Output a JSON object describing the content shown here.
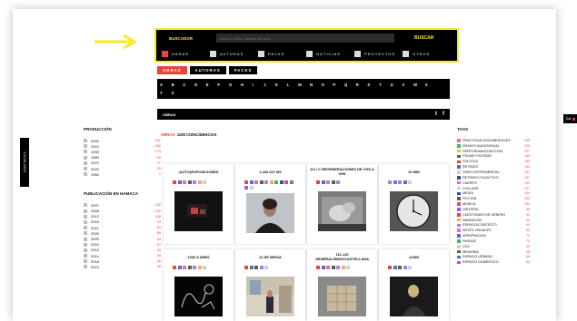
{
  "search": {
    "label": "BUSCADOR",
    "placeholder": "entra un título, nombre de autor ...",
    "button": "BUSCAR",
    "filters": [
      {
        "label": "OBRAS",
        "checked": true
      },
      {
        "label": "AUTORAS",
        "checked": false
      },
      {
        "label": "PACKS",
        "checked": false
      },
      {
        "label": "NOTICIAS",
        "checked": false
      },
      {
        "label": "PROYECTOS",
        "checked": false
      },
      {
        "label": "OTROS",
        "checked": false
      }
    ]
  },
  "tabs": [
    {
      "label": "OBRAS",
      "active": true
    },
    {
      "label": "AUTORAS",
      "active": false
    },
    {
      "label": "PACKS",
      "active": false
    }
  ],
  "alphabet": [
    "A",
    "B",
    "C",
    "D",
    "E",
    "F",
    "G",
    "H",
    "I",
    "J",
    "K",
    "L",
    "M",
    "N",
    "O",
    "P",
    "Q",
    "R",
    "S",
    "T",
    "U",
    "V",
    "W",
    "X",
    "Y",
    "Z"
  ],
  "obras_bar": {
    "title": "OBRAS",
    "twitter": "t",
    "facebook": "f"
  },
  "results": {
    "prefix": "OBRAS:",
    "count_text": "1198 COINCIDENCIAS"
  },
  "sidebar_tab": "CATÁLOGO",
  "lang_tab": "CA",
  "produccion": {
    "title": "PRODUCCIÓN",
    "dots": "• • •",
    "items": [
      {
        "label": "2000",
        "count": "541"
      },
      {
        "label": "2010",
        "count": "281"
      },
      {
        "label": "1990",
        "count": "179"
      },
      {
        "label": "1980",
        "count": "59"
      },
      {
        "label": "1970",
        "count": "27"
      },
      {
        "label": "2020",
        "count": "25"
      },
      {
        "label": "1960",
        "count": "1"
      }
    ]
  },
  "publicacion": {
    "title": "PUBLICACIÓN EN HAMACA",
    "dots": "• • •",
    "items": [
      {
        "label": "2007",
        "count": "230"
      },
      {
        "label": "2008",
        "count": "126"
      },
      {
        "label": "2012",
        "count": "126"
      },
      {
        "label": "2016",
        "count": "93"
      },
      {
        "label": "2011",
        "count": "84"
      },
      {
        "label": "2020",
        "count": "85"
      },
      {
        "label": "2009",
        "count": "63"
      },
      {
        "label": "2010",
        "count": "63"
      },
      {
        "label": "2015",
        "count": "53"
      },
      {
        "label": "2014",
        "count": "49"
      },
      {
        "label": "2018",
        "count": "38"
      },
      {
        "label": "2019",
        "count": "35"
      }
    ]
  },
  "cards": [
    {
      "title": "¡AUTO)EXPOSICIONES",
      "swatches": [
        "#e8443a",
        "#4a6fd6",
        "#e66fb0",
        "#5c5c5c",
        "#b07cd9",
        "#f0b050",
        "#cfcfcf"
      ],
      "thumb": "dark-performance"
    },
    {
      "title": "1.432.027 M2",
      "swatches": [
        "#e8443a",
        "#4a6fd6",
        "#e66fb0",
        "#5c5c5c",
        "#b07cd9",
        "#f0b050",
        "#45b36b",
        "#2f4fa0",
        "#d64a8a",
        "#7f7f7f",
        "#a05ed0",
        "#cfcfcf"
      ],
      "thumb": "portrait"
    },
    {
      "title": "1/4 / C REGENERACIONES DE VHS A VHS",
      "swatches": [
        "#e8443a",
        "#4a6fd6",
        "#e66fb0",
        "#5c5c5c",
        "#b07cd9"
      ],
      "thumb": "bw-baby"
    },
    {
      "title": "10 MIN",
      "swatches": [
        "#8f8fe0",
        "#6a7bd8",
        "#b07cd9",
        "#4a6fd6",
        "#cfcfcf"
      ],
      "thumb": "clock"
    },
    {
      "title": "1000 A MIRÓ",
      "swatches": [
        "#e8443a",
        "#4a6fd6",
        "#e66fb0",
        "#5c5c5c",
        "#b07cd9",
        "#f0b050",
        "#cfcfcf"
      ],
      "thumb": "drawing"
    },
    {
      "title": "11 DE MEDIA",
      "swatches": [
        "#e8443a",
        "#4a6fd6",
        "#5c5c5c",
        "#b07cd9",
        "#cfcfcf"
      ],
      "thumb": "room"
    },
    {
      "title": "111-119 GENERALÍSIMO/CASTELLANA",
      "swatches": [
        "#e8443a",
        "#4a6fd6",
        "#e66fb0",
        "#5c5c5c",
        "#b07cd9",
        "#f0b050",
        "#cfcfcf"
      ],
      "thumb": "boxes"
    },
    {
      "title": "123M!",
      "swatches": [
        "#e8443a",
        "#4a6fd6",
        "#5c5c5c",
        "#b07cd9",
        "#cfcfcf"
      ],
      "thumb": "figure"
    }
  ],
  "tags": {
    "title": "TAGS",
    "dots": "• • •",
    "items": [
      {
        "label": "PRÁCTICAS DOCUMENTALES",
        "count": "345",
        "color": "#e66fb0"
      },
      {
        "label": "ENSAYO AUDIOVISUAL",
        "count": "226",
        "color": "#45b36b"
      },
      {
        "label": "PERFORMANCE/ACCIÓN",
        "count": "217",
        "color": "#f0c419"
      },
      {
        "label": "FOUND FOOTAGE",
        "count": "165",
        "color": "#5c5c5c"
      },
      {
        "label": "POLÍTICA",
        "count": "160",
        "color": "#e8443a"
      },
      {
        "label": "RETRATO",
        "count": "144",
        "color": "#4a6fd6"
      },
      {
        "label": "VIDEO EXPERIMENTAL",
        "count": "141",
        "color": "#cfcfcf"
      },
      {
        "label": "RETRATO COLECTIVO",
        "count": "131",
        "color": "#2f4fa0"
      },
      {
        "label": "CUERPO",
        "count": "120",
        "color": "#e66fb0"
      },
      {
        "label": "COLLAGE",
        "count": "117",
        "color": "#cfcfcf"
      },
      {
        "label": "MEDIA",
        "count": "114",
        "color": "#2f4fa0"
      },
      {
        "label": "FICCIÓN",
        "count": "103",
        "color": "#5c5c5c"
      },
      {
        "label": "MÚSICA",
        "count": "103",
        "color": "#d64a8a"
      },
      {
        "label": "HISTORIA",
        "count": "96",
        "color": "#a05ed0"
      },
      {
        "label": "CUESTIONES DE GÉNERO",
        "count": "92",
        "color": "#e8443a"
      },
      {
        "label": "ANIMACIÓN",
        "count": "90",
        "color": "#f0b050"
      },
      {
        "label": "ESPACIO/CONTEXTO",
        "count": "90",
        "color": "#b07cd9"
      },
      {
        "label": "ARTES VISUALES",
        "count": "83",
        "color": "#e66fb0"
      },
      {
        "label": "APROPIACIÓN",
        "count": "73",
        "color": "#4a6fd6"
      },
      {
        "label": "PAISAJE",
        "count": "70",
        "color": "#45b36b"
      },
      {
        "label": "VOZ",
        "count": "69",
        "color": "#cfcfcf"
      },
      {
        "label": "MEMORIA",
        "count": "68",
        "color": "#5c5c5c"
      },
      {
        "label": "ESPACIO URBANO",
        "count": "66",
        "color": "#4a6fd6"
      },
      {
        "label": "ESPACIO DOMÉSTICO",
        "count": "64",
        "color": "#a05ed0"
      }
    ]
  }
}
